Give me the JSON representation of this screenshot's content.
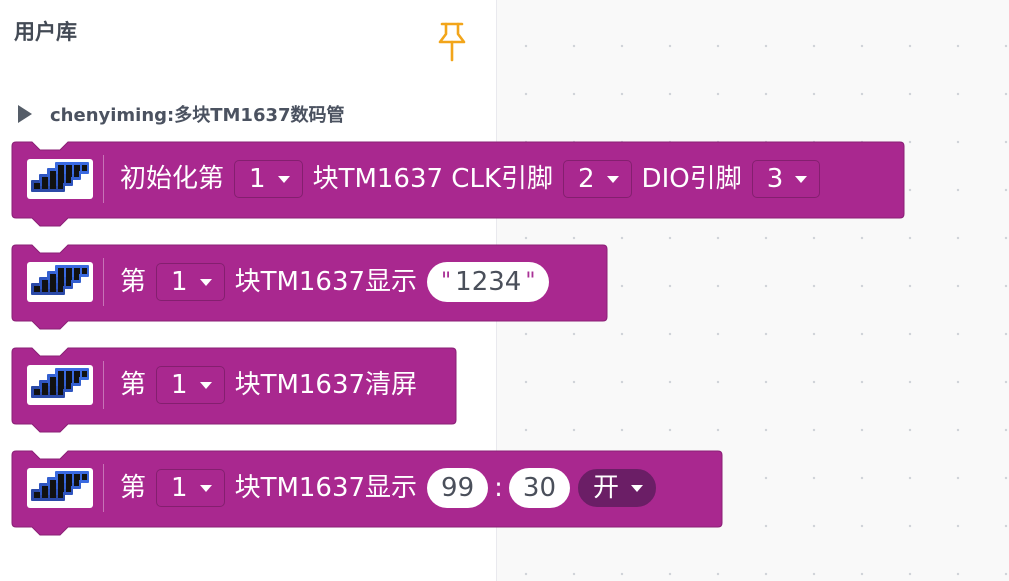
{
  "flyout": {
    "title": "用户库",
    "category": "chenyiming:多块TM1637数码管"
  },
  "colors": {
    "block": "#a9288f",
    "block_border": "#8a1f75",
    "dropdown_dark": "#6b1e66",
    "string_quote": "#a93296",
    "pin_icon": "#f2a51a"
  },
  "icons": [
    "pin-icon",
    "expand-arrow-icon",
    "tm1637-display-icon",
    "dropdown-caret-icon"
  ],
  "blocks": {
    "init": {
      "t1": "初始化第",
      "d1": "1",
      "t2": "块TM1637 CLK引脚",
      "d2": "2",
      "t3": "DIO引脚",
      "d3": "3"
    },
    "show_str": {
      "t1": "第",
      "d1": "1",
      "t2": "块TM1637显示",
      "quote_open": "\"",
      "value": "1234",
      "quote_close": "\""
    },
    "clear": {
      "t1": "第",
      "d1": "1",
      "t2": "块TM1637清屏"
    },
    "show_time": {
      "t1": "第",
      "d1": "1",
      "t2": "块TM1637显示",
      "v1": "99",
      "sep": ":",
      "v2": "30",
      "d2": "开"
    }
  }
}
